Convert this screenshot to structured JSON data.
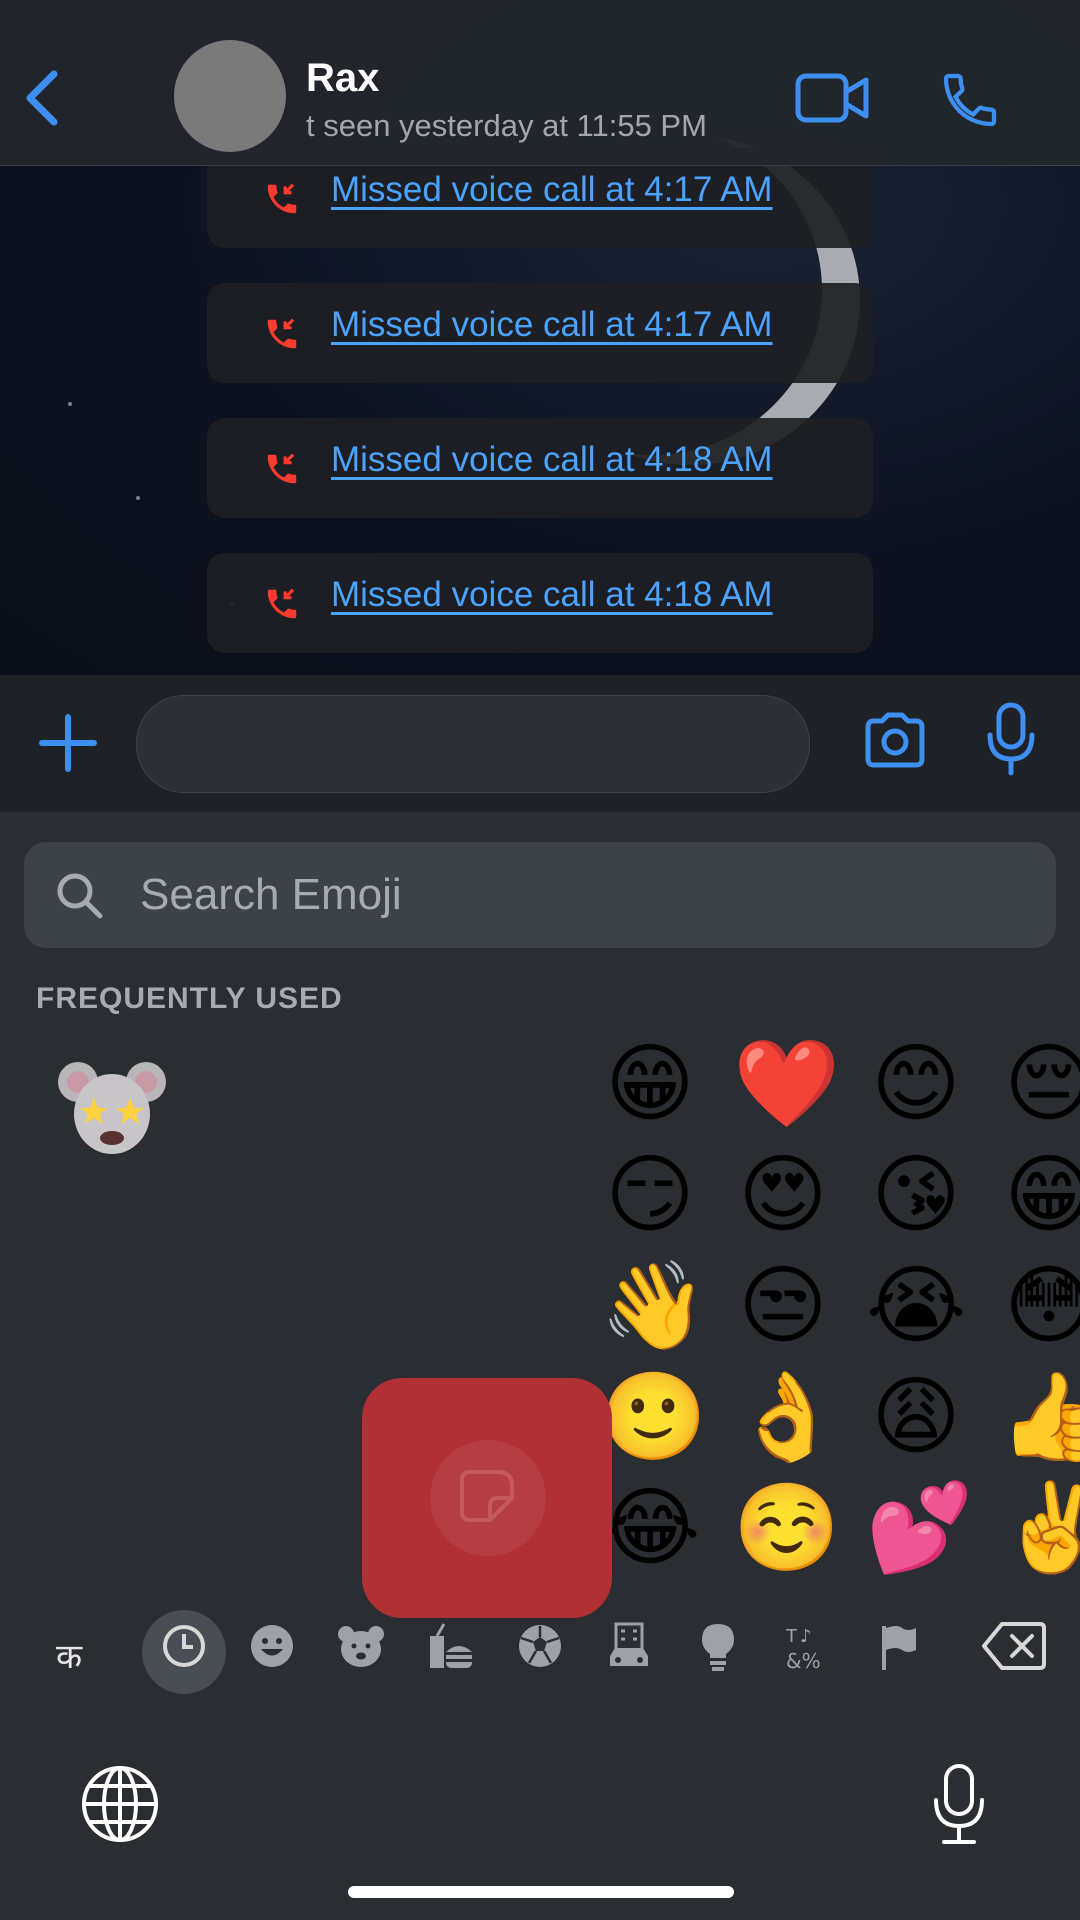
{
  "header": {
    "back_icon": "chevron-left-icon",
    "contact_name": "Rax",
    "last_seen": "t seen yesterday at 11:55 PM",
    "video_icon": "video-camera-icon",
    "call_icon": "phone-icon",
    "accent_color": "#3d8ff2"
  },
  "messages": [
    {
      "text": "Missed voice call at 4:17 AM"
    },
    {
      "text": "Missed voice call at 4:17 AM"
    },
    {
      "text": "Missed voice call at 4:18 AM"
    },
    {
      "text": "Missed voice call at 4:18 AM"
    }
  ],
  "composer": {
    "plus_icon": "plus-icon",
    "sticker_icon": "sticker-icon",
    "camera_icon": "camera-icon",
    "mic_icon": "microphone-icon",
    "text_value": ""
  },
  "emoji_keyboard": {
    "search_placeholder": "Search Emoji",
    "section_title": "FREQUENTLY USED",
    "memoji": "mouse-memoji-star-eyes",
    "emojis": [
      "😁",
      "❤️",
      "😊",
      "😔",
      "😏",
      "😍",
      "😘",
      "😁",
      "👋",
      "😒",
      "😭",
      "😳",
      "🙂",
      "👌",
      "😩",
      "👍",
      "😂",
      "☺️",
      "💕",
      "✌️"
    ],
    "language_key": "क",
    "categories": [
      "recent-icon",
      "smileys-icon",
      "animals-icon",
      "food-icon",
      "activity-icon",
      "travel-icon",
      "objects-icon",
      "symbols-icon",
      "flags-icon"
    ],
    "delete_icon": "backspace-icon",
    "globe_icon": "globe-icon",
    "dictation_icon": "microphone-icon"
  }
}
